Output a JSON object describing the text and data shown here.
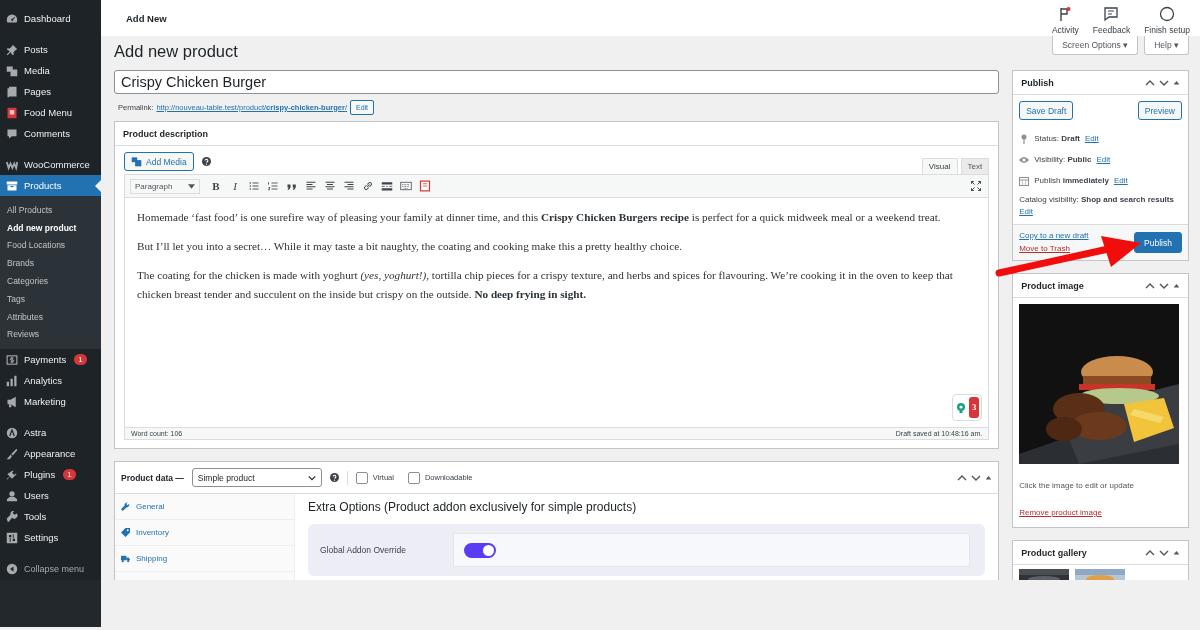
{
  "sidebar": {
    "groups": [
      [
        {
          "label": "Dashboard",
          "selected": false
        }
      ],
      [
        {
          "label": "Posts",
          "selected": false
        },
        {
          "label": "Media",
          "selected": false
        },
        {
          "label": "Pages",
          "selected": false
        },
        {
          "label": "Food Menu",
          "selected": false
        },
        {
          "label": "Comments",
          "selected": false
        }
      ],
      [
        {
          "label": "WooCommerce",
          "selected": false
        },
        {
          "label": "Products",
          "selected": true,
          "children": [
            {
              "label": "All Products",
              "selected": false
            },
            {
              "label": "Add new product",
              "selected": true
            },
            {
              "label": "Food Locations",
              "selected": false
            },
            {
              "label": "Brands",
              "selected": false
            },
            {
              "label": "Categories",
              "selected": false
            },
            {
              "label": "Tags",
              "selected": false
            },
            {
              "label": "Attributes",
              "selected": false
            },
            {
              "label": "Reviews",
              "selected": false
            }
          ]
        },
        {
          "label": "Payments",
          "selected": false,
          "badge": "1"
        },
        {
          "label": "Analytics",
          "selected": false
        },
        {
          "label": "Marketing",
          "selected": false
        }
      ],
      [
        {
          "label": "Astra",
          "selected": false
        },
        {
          "label": "Appearance",
          "selected": false
        },
        {
          "label": "Plugins",
          "selected": false,
          "badge": "1"
        },
        {
          "label": "Users",
          "selected": false
        },
        {
          "label": "Tools",
          "selected": false
        },
        {
          "label": "Settings",
          "selected": false
        }
      ]
    ],
    "collapse": "Collapse menu"
  },
  "topbar": {
    "title": "Add New",
    "actions": [
      {
        "label": "Activity",
        "notify": true
      },
      {
        "label": "Feedback",
        "notify": false
      },
      {
        "label": "Finish setup",
        "notify": false
      }
    ]
  },
  "page_title": "Add new product",
  "screen_buttons": [
    "Screen Options ▾",
    "Help ▾"
  ],
  "title_field": {
    "value": "Crispy Chicken Burger"
  },
  "permalink": {
    "label": "Permalink:",
    "url": "http://nouveau-table.test/product/**crispy-chicken-burger**/",
    "edit": "Edit"
  },
  "description": {
    "title": "Product description",
    "add_media": "Add Media",
    "tabs": [
      {
        "label": "Visual",
        "selected": true
      },
      {
        "label": "Text",
        "selected": false
      }
    ],
    "format": "Paragraph",
    "glyphs": [
      "B",
      "I"
    ],
    "paragraphs": [
      "Homemade ‘fast food’ is one surefire way of pleasing your family at dinner time, and this **Crispy Chicken Burgers recipe** is perfect for a quick midweek meal or a weekend treat.",
      "But I’ll let you into a secret… While it may taste a bit naughty, the coating and cooking make this a pretty healthy choice.",
      "The coating for the chicken is made with yoghurt *(yes, yoghurt!)*, tortilla chip pieces for a crispy texture, and herbs and spices for flavouring. We’re cooking it in the oven to keep that chicken breast tender and succulent on the inside but crispy on the outside. **No deep frying in sight.**"
    ],
    "grammar_count": "3",
    "word_count": "Word count: 106",
    "saved": "Draft saved at 10:48:16 am."
  },
  "product_data": {
    "label": "Product data —",
    "type": "Simple product",
    "options": [
      {
        "label": "Virtual",
        "checked": false
      },
      {
        "label": "Downloadable",
        "checked": false
      }
    ],
    "tabs": [
      {
        "label": "General",
        "selected": false
      },
      {
        "label": "Inventory",
        "selected": false
      },
      {
        "label": "Shipping",
        "selected": false
      }
    ],
    "panel_title": "Extra Options (Product addon exclusively for simple products)",
    "setting": {
      "label": "Global Addon Override",
      "on": true
    }
  },
  "publish": {
    "title": "Publish",
    "save_draft": "Save Draft",
    "preview": "Preview",
    "rows": [
      {
        "label": "Status:",
        "value": "Draft",
        "edit": "Edit"
      },
      {
        "label": "Visibility:",
        "value": "Public",
        "edit": "Edit"
      },
      {
        "label": "Publish",
        "value": "immediately",
        "edit": "Edit"
      }
    ],
    "catalog": {
      "label": "Catalog visibility:",
      "value": "Shop and search results",
      "edit": "Edit"
    },
    "copy": "Copy to a new draft",
    "trash": "Move to Trash",
    "button": "Publish"
  },
  "product_image": {
    "title": "Product image",
    "hint": "Click the image to edit or update",
    "remove": "Remove product image"
  },
  "gallery": {
    "title": "Product gallery"
  }
}
